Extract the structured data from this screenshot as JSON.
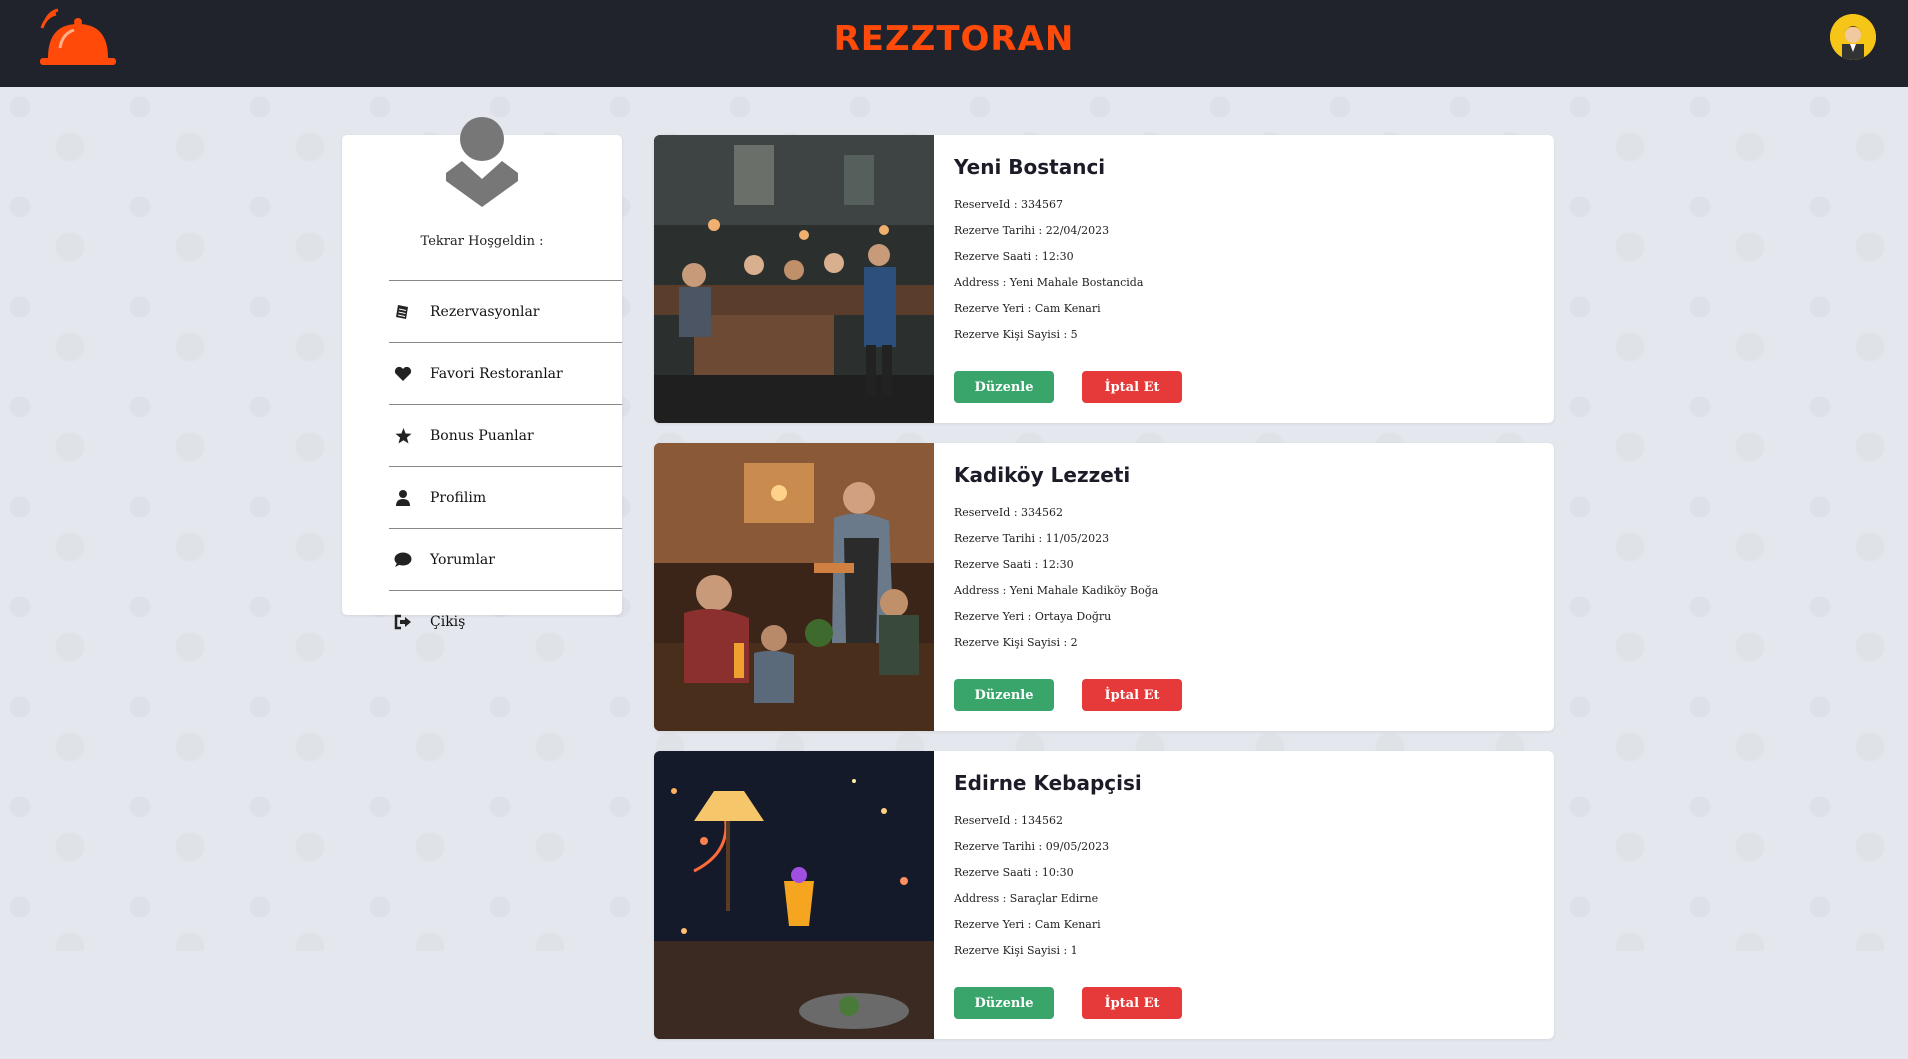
{
  "header": {
    "brand": "REZZTORAN"
  },
  "sidebar": {
    "welcome": "Tekrar Hoşgeldin :",
    "items": [
      {
        "label": "Rezervasyonlar",
        "icon": "receipt-icon"
      },
      {
        "label": "Favori Restoranlar",
        "icon": "heart-icon"
      },
      {
        "label": "Bonus Puanlar",
        "icon": "star-icon"
      },
      {
        "label": "Profilim",
        "icon": "user-icon"
      },
      {
        "label": "Yorumlar",
        "icon": "comment-icon"
      },
      {
        "label": "Çikiş",
        "icon": "sign-out-icon"
      }
    ]
  },
  "reservations": [
    {
      "name": "Yeni Bostanci",
      "id": "ReserveId : 334567",
      "date": "Rezerve Tarihi : 22/04/2023",
      "time": "Rezerve Saati : 12:30",
      "address": "Address : Yeni Mahale Bostancida",
      "place": "Rezerve Yeri : Cam Kenari",
      "people": "Rezerve Kişi Sayisi : 5"
    },
    {
      "name": "Kadiköy Lezzeti",
      "id": "ReserveId : 334562",
      "date": "Rezerve Tarihi : 11/05/2023",
      "time": "Rezerve Saati : 12:30",
      "address": "Address : Yeni Mahale Kadiköy Boğa",
      "place": "Rezerve Yeri : Ortaya Doğru",
      "people": "Rezerve Kişi Sayisi : 2"
    },
    {
      "name": "Edirne Kebapçisi",
      "id": "ReserveId : 134562",
      "date": "Rezerve Tarihi : 09/05/2023",
      "time": "Rezerve Saati : 10:30",
      "address": "Address : Saraçlar Edirne",
      "place": "Rezerve Yeri : Cam Kenari",
      "people": "Rezerve Kişi Sayisi : 1"
    }
  ],
  "buttons": {
    "edit": "Düzenle",
    "cancel": "İptal Et"
  },
  "colors": {
    "header": "#20232c",
    "brand": "#ff4a0a",
    "edit": "#3aa56b",
    "cancel": "#e63a3a"
  }
}
